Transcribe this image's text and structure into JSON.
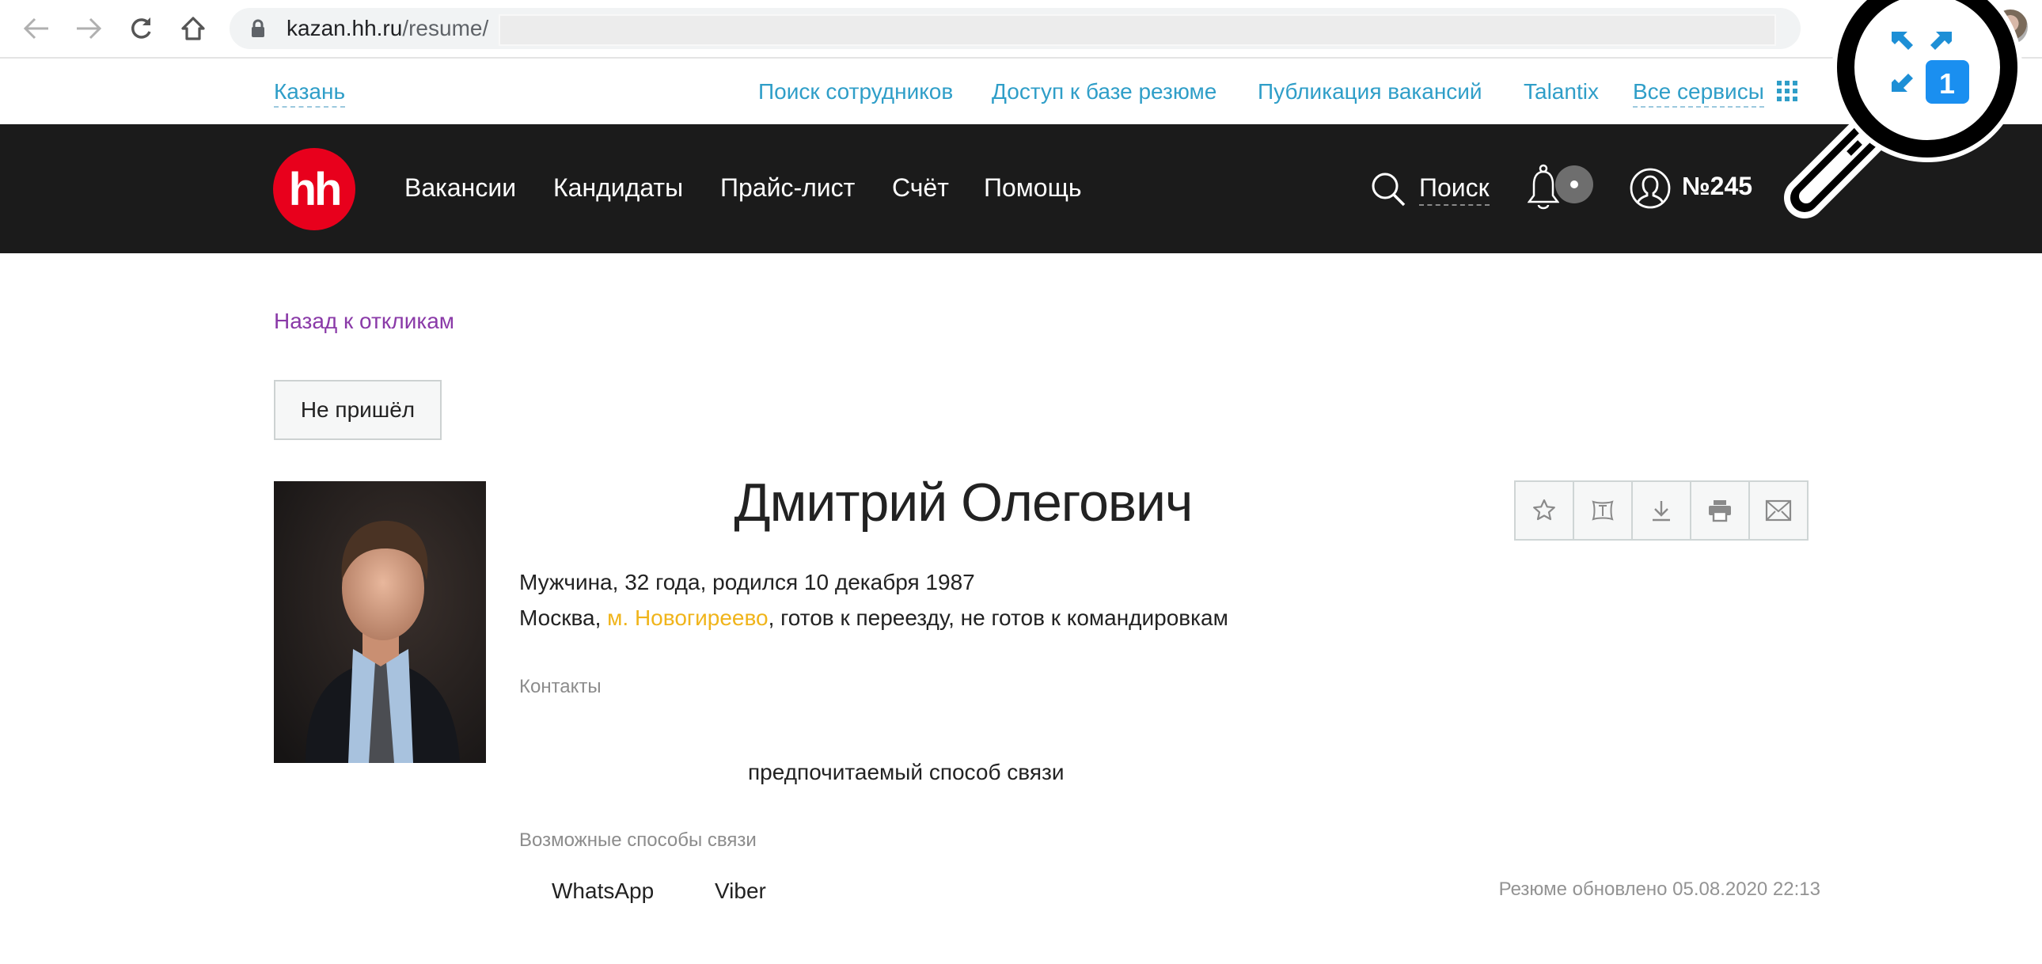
{
  "browser": {
    "url_host": "kazan.hh.ru",
    "url_path": "/resume/"
  },
  "top_links": {
    "city": "Казань",
    "items": [
      {
        "label": "Поиск сотрудников"
      },
      {
        "label": "Доступ к базе резюме"
      },
      {
        "label": "Публикация вакансий"
      },
      {
        "label": "Talantix"
      },
      {
        "label": "Все сервисы"
      }
    ]
  },
  "header": {
    "logo_text": "hh",
    "nav": [
      {
        "label": "Вакансии"
      },
      {
        "label": "Кандидаты"
      },
      {
        "label": "Прайс-лист"
      },
      {
        "label": "Счёт"
      },
      {
        "label": "Помощь"
      }
    ],
    "search_label": "Поиск",
    "account_number": "№245",
    "brand_color": "#e8001c"
  },
  "overlay": {
    "badge_count": "1"
  },
  "resume": {
    "back_link": "Назад к откликам",
    "status_button": "Не пришёл",
    "name": "Дмитрий Олегович",
    "actions": [
      {
        "icon": "star-icon",
        "label": "Добавить в избранное"
      },
      {
        "icon": "talantix-icon",
        "label": "Talantix"
      },
      {
        "icon": "download-icon",
        "label": "Скачать"
      },
      {
        "icon": "print-icon",
        "label": "Печать"
      },
      {
        "icon": "mail-icon",
        "label": "Отправить"
      }
    ],
    "personal_info": "Мужчина, 32 года, родился 10 декабря 1987",
    "location_city": "Москва, ",
    "location_metro": "м. Новогиреево",
    "location_rest": ", готов к переезду, не готов к командировкам",
    "contacts_label": "Контакты",
    "preferred_contact": "предпочитаемый способ связи",
    "possible_contacts_label": "Возможные способы связи",
    "messengers": [
      "WhatsApp",
      "Viber"
    ],
    "updated": "Резюме обновлено 05.08.2020 22:13"
  }
}
